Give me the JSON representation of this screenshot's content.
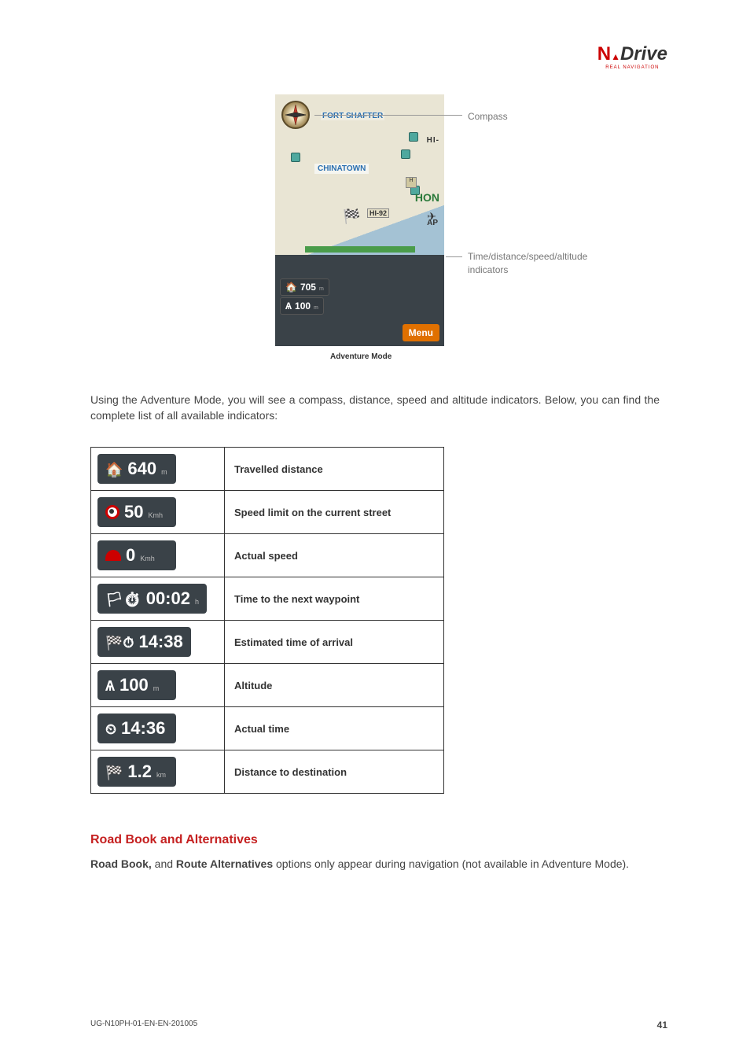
{
  "logo": {
    "letter": "N",
    "rest": "Drive",
    "sub": "REAL NAVIGATION"
  },
  "screenshot": {
    "caption": "Adventure Mode",
    "labels": {
      "fort": "FORT SHAFTER",
      "china": "CHINATOWN",
      "hi1": "HI-",
      "hon": "HON",
      "hi92": "HI-92",
      "ap": "AP",
      "shield_h": "H"
    },
    "indicators": {
      "distance_val": "705",
      "distance_unit": "m",
      "altitude_val": "100",
      "altitude_unit": "m"
    },
    "menu_label": "Menu"
  },
  "callouts": {
    "compass": "Compass",
    "indicators": "Time/distance/speed/altitude indicators"
  },
  "body_text": "Using the Adventure Mode, you will see a compass, distance, speed and altitude indicators. Below, you can find the complete list of all available indicators:",
  "table": [
    {
      "value": "640",
      "unit": "m",
      "icon": "dist",
      "label": "Travelled distance"
    },
    {
      "value": "50",
      "unit": "Kmh",
      "icon": "speedlimit",
      "label": "Speed limit on the current street"
    },
    {
      "value": "0",
      "unit": "Kmh",
      "icon": "speed",
      "label": "Actual speed"
    },
    {
      "value": "00:02",
      "unit": "h",
      "icon": "timewp",
      "label": "Time to the next waypoint"
    },
    {
      "value": "14:38",
      "unit": "",
      "icon": "eta",
      "label": "Estimated time of arrival"
    },
    {
      "value": "100",
      "unit": "m",
      "icon": "altitude",
      "label": "Altitude"
    },
    {
      "value": "14:36",
      "unit": "",
      "icon": "clock",
      "label": "Actual time"
    },
    {
      "value": "1.2",
      "unit": "km",
      "icon": "distdest",
      "label": "Distance to destination"
    }
  ],
  "section_heading": "Road Book and Alternatives",
  "section_body_before": "Road Book,",
  "section_body_mid": " and ",
  "section_body_bold2": "Route Alternatives",
  "section_body_after": " options only appear during navigation (not available in Adventure Mode).",
  "footer": {
    "doc_id": "UG-N10PH-01-EN-EN-201005",
    "page": "41"
  }
}
